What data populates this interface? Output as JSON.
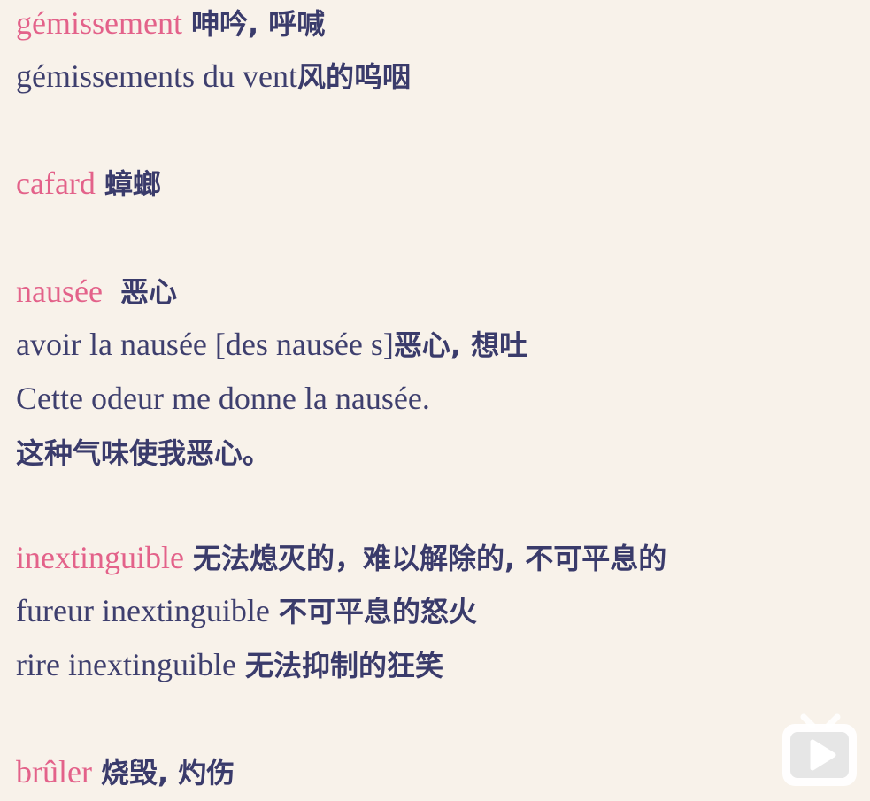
{
  "entries": [
    {
      "term": "gémissement",
      "meaning": "呻吟, 呼喊",
      "examples": [
        {
          "fr": "gémissements du vent",
          "zh": "风的呜咽"
        }
      ]
    },
    {
      "term": "cafard",
      "meaning": "蟑螂",
      "examples": []
    },
    {
      "term": "nausée",
      "meaning": "恶心",
      "examples": [
        {
          "fr": "avoir la nausée [des nausée s]",
          "zh": "恶心, 想吐"
        },
        {
          "fr": "Cette odeur me donne la nausée.",
          "zh": ""
        },
        {
          "fr": "",
          "zh": "这种气味使我恶心。"
        }
      ]
    },
    {
      "term": "inextinguible",
      "meaning": "无法熄灭的，难以解除的, 不可平息的",
      "examples": [
        {
          "fr": "fureur inextinguible",
          "zh": "不可平息的怒火"
        },
        {
          "fr": "rire inextinguible",
          "zh": "无法抑制的狂笑"
        }
      ]
    },
    {
      "term": "brûler",
      "meaning": "烧毁, 灼伤",
      "examples": []
    }
  ],
  "overlay": {
    "icon": "play-icon",
    "color": "#ffffff"
  },
  "colors": {
    "background": "#f8f2ea",
    "term": "#e3628a",
    "text": "#3e3f6e"
  }
}
